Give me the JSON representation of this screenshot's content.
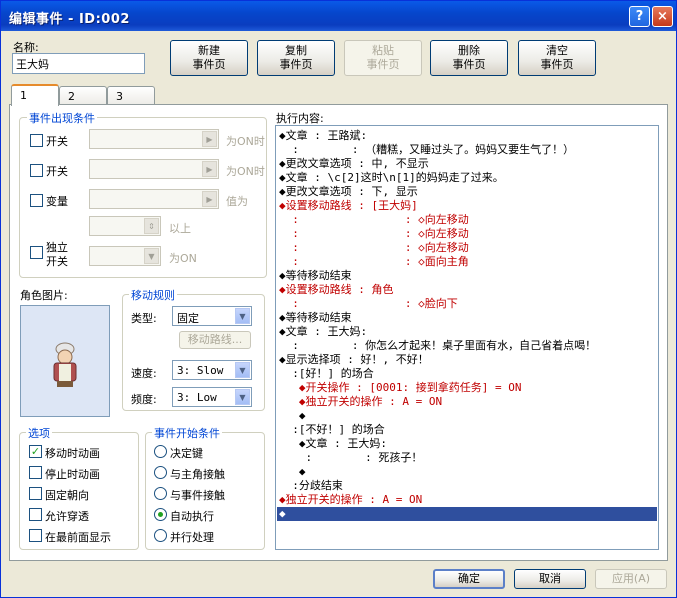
{
  "window": {
    "title": "编辑事件 - ID:002",
    "help_icon": "?",
    "close_icon": "×"
  },
  "name": {
    "label": "名称:",
    "value": "王大妈"
  },
  "toolbar": {
    "new_page": "新建\n事件页",
    "copy_page": "复制\n事件页",
    "paste_page": "粘贴\n事件页",
    "delete_page": "删除\n事件页",
    "clear_page": "清空\n事件页"
  },
  "tabs": [
    "1",
    "2",
    "3"
  ],
  "conditions": {
    "title": "事件出现条件",
    "switch1_label": "开关",
    "switch1_suffix": "为ON时",
    "switch2_label": "开关",
    "switch2_suffix": "为ON时",
    "variable_label": "变量",
    "variable_suffix": "值为",
    "above_suffix": "以上",
    "self_switch_label": "独立\n开关",
    "self_switch_suffix": "为ON"
  },
  "graphic": {
    "label": "角色图片:"
  },
  "movement": {
    "title": "移动规则",
    "type_label": "类型:",
    "type_value": "固定",
    "route_button": "移动路线...",
    "speed_label": "速度:",
    "speed_value": "3: Slow",
    "freq_label": "频度:",
    "freq_value": "3: Low"
  },
  "options": {
    "title": "选项",
    "items": [
      {
        "label": "移动时动画",
        "checked": true
      },
      {
        "label": "停止时动画",
        "checked": false
      },
      {
        "label": "固定朝向",
        "checked": false
      },
      {
        "label": "允许穿透",
        "checked": false
      },
      {
        "label": "在最前面显示",
        "checked": false
      }
    ]
  },
  "trigger": {
    "title": "事件开始条件",
    "items": [
      {
        "label": "决定键",
        "selected": false
      },
      {
        "label": "与主角接触",
        "selected": false
      },
      {
        "label": "与事件接触",
        "selected": false
      },
      {
        "label": "自动执行",
        "selected": true
      },
      {
        "label": "并行处理",
        "selected": false
      }
    ]
  },
  "execution": {
    "label": "执行内容:",
    "lines": [
      {
        "text": "◆文章 : 王路斌:",
        "style": "normal"
      },
      {
        "text": "  :        : （糟糕，又睡过头了。妈妈又要生气了！）",
        "style": "normal"
      },
      {
        "text": "◆更改文章选项 : 中, 不显示",
        "style": "normal"
      },
      {
        "text": "◆文章 : \\c[2]这时\\n[1]的妈妈走了过来。",
        "style": "normal"
      },
      {
        "text": "◆更改文章选项 : 下, 显示",
        "style": "normal"
      },
      {
        "text": "◆设置移动路线 : [王大妈]",
        "style": "red"
      },
      {
        "text": "  :                : ◇向左移动",
        "style": "red"
      },
      {
        "text": "  :                : ◇向左移动",
        "style": "red"
      },
      {
        "text": "  :                : ◇向左移动",
        "style": "red"
      },
      {
        "text": "  :                : ◇面向主角",
        "style": "red"
      },
      {
        "text": "◆等待移动结束",
        "style": "normal"
      },
      {
        "text": "◆设置移动路线 : 角色",
        "style": "red"
      },
      {
        "text": "  :                : ◇脸向下",
        "style": "red"
      },
      {
        "text": "◆等待移动结束",
        "style": "normal"
      },
      {
        "text": "◆文章 : 王大妈:",
        "style": "normal"
      },
      {
        "text": "  :        : 你怎么才起来！桌子里面有水，自己省着点喝！",
        "style": "normal"
      },
      {
        "text": "◆显示选择项 : 好！, 不好！",
        "style": "normal"
      },
      {
        "text": "  :[好！] 的场合",
        "style": "normal"
      },
      {
        "text": "   ◆开关操作 : [0001: 接到拿药任务] = ON",
        "style": "red"
      },
      {
        "text": "   ◆独立开关的操作 : A = ON",
        "style": "red"
      },
      {
        "text": "   ◆",
        "style": "normal"
      },
      {
        "text": "  :[不好！] 的场合",
        "style": "normal"
      },
      {
        "text": "   ◆文章 : 王大妈:",
        "style": "normal"
      },
      {
        "text": "    :        : 死孩子！",
        "style": "normal"
      },
      {
        "text": "   ◆",
        "style": "normal"
      },
      {
        "text": "  :分歧结束",
        "style": "normal"
      },
      {
        "text": "◆独立开关的操作 : A = ON",
        "style": "red"
      },
      {
        "text": "◆",
        "style": "selected"
      }
    ]
  },
  "footer": {
    "ok": "确定",
    "cancel": "取消",
    "apply": "应用(A)"
  }
}
